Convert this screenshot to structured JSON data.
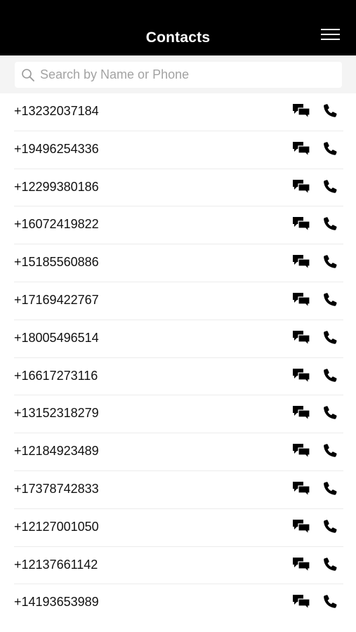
{
  "header": {
    "title": "Contacts",
    "menu_icon": "hamburger-menu-icon"
  },
  "search": {
    "placeholder": "Search by Name or Phone",
    "value": "",
    "icon": "search-icon"
  },
  "contacts": [
    {
      "phone": "+13232037184"
    },
    {
      "phone": "+19496254336"
    },
    {
      "phone": "+12299380186"
    },
    {
      "phone": "+16072419822"
    },
    {
      "phone": "+15185560886"
    },
    {
      "phone": "+17169422767"
    },
    {
      "phone": "+18005496514"
    },
    {
      "phone": "+16617273116"
    },
    {
      "phone": "+13152318279"
    },
    {
      "phone": "+12184923489"
    },
    {
      "phone": "+17378742833"
    },
    {
      "phone": "+12127001050"
    },
    {
      "phone": "+12137661142"
    },
    {
      "phone": "+14193653989"
    }
  ],
  "row_icons": {
    "message": "chat-bubbles-icon",
    "call": "phone-handset-icon"
  },
  "colors": {
    "header_bg": "#000000",
    "header_text": "#ffffff",
    "search_bar_bg": "#f4f4f4",
    "placeholder": "#a3a3a3",
    "divider": "#ececec"
  }
}
